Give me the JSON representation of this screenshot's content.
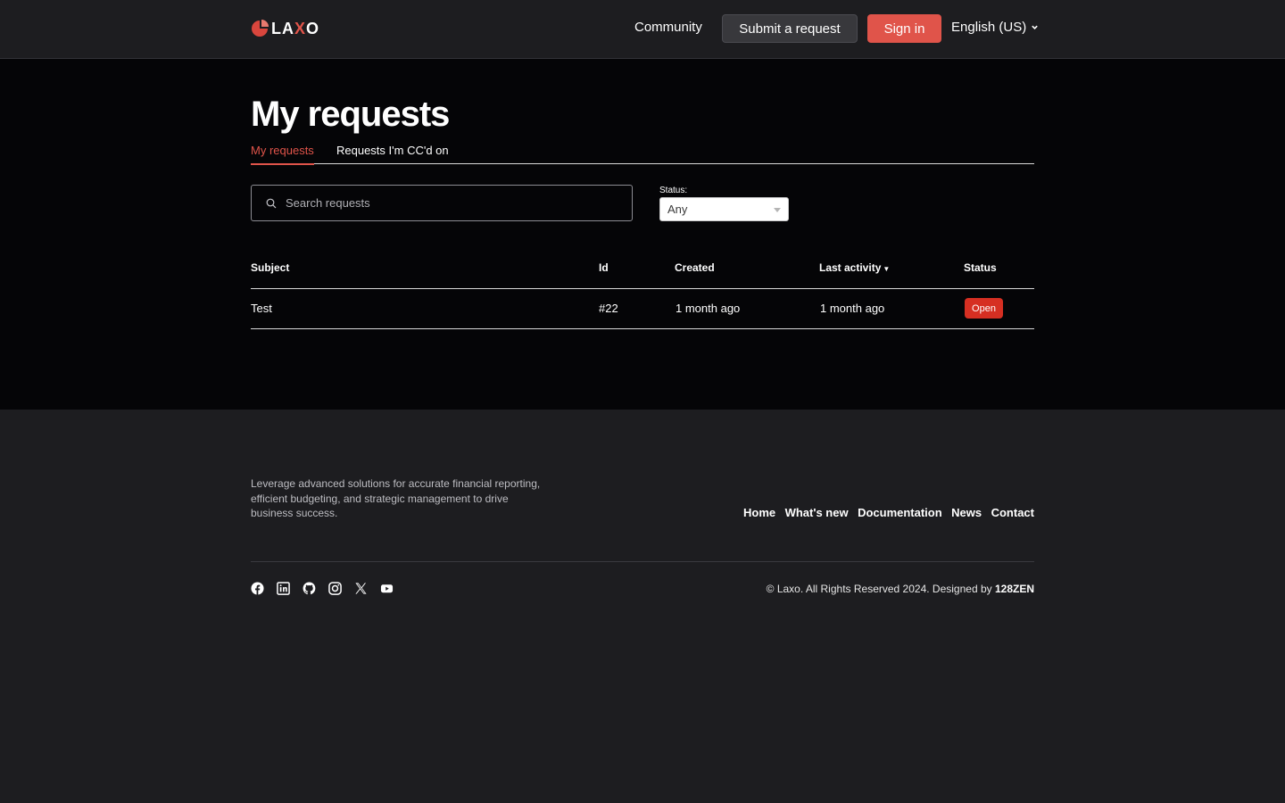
{
  "header": {
    "logo_text_a": "LA",
    "logo_text_x": "X",
    "logo_text_b": "O",
    "community": "Community",
    "submit_request": "Submit a request",
    "sign_in": "Sign in",
    "language": "English (US)"
  },
  "main": {
    "title": "My requests",
    "tabs": [
      {
        "label": "My requests",
        "active": true
      },
      {
        "label": "Requests I'm CC'd on",
        "active": false
      }
    ],
    "search": {
      "placeholder": "Search requests",
      "value": ""
    },
    "status_filter": {
      "label": "Status:",
      "selected": "Any"
    }
  },
  "table": {
    "columns": [
      "Subject",
      "Id",
      "Created",
      "Last activity",
      "Status"
    ],
    "sort_indicator": "▼",
    "rows": [
      {
        "subject": "Test",
        "id": "#22",
        "created": "1 month ago",
        "last_activity": "1 month ago",
        "status": "Open"
      }
    ]
  },
  "footer": {
    "description": "Leverage advanced solutions for accurate financial reporting, efficient budgeting, and strategic management to drive business success.",
    "links": [
      "Home",
      "What's new",
      "Documentation",
      "News",
      "Contact"
    ],
    "socials": [
      "facebook-icon",
      "linkedin-icon",
      "github-icon",
      "instagram-icon",
      "x-icon",
      "youtube-icon"
    ],
    "copyright": "© Laxo. All Rights Reserved 2024. Designed by ",
    "designer": "128ZEN"
  },
  "colors": {
    "accent": "#e0544a",
    "badge_open": "#d62f22",
    "header_bg": "#1d1d20",
    "main_bg": "#050507"
  }
}
